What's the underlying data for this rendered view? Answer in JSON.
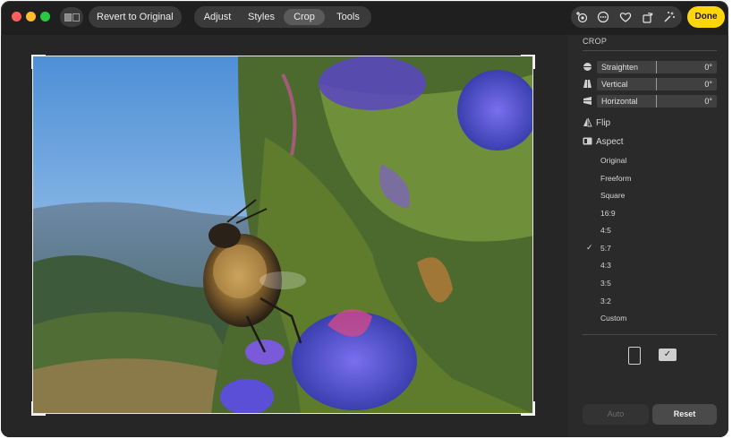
{
  "toolbar": {
    "revert_label": "Revert to Original",
    "tabs": [
      {
        "label": "Adjust"
      },
      {
        "label": "Styles"
      },
      {
        "label": "Crop",
        "active": true
      },
      {
        "label": "Tools"
      }
    ],
    "icons": [
      "add-enhance-icon",
      "more-icon",
      "favorite-heart-icon",
      "rotate-icon",
      "auto-enhance-wand-icon"
    ],
    "done_label": "Done",
    "done_color": "#ffd60a"
  },
  "crop_panel": {
    "title": "CROP",
    "sliders": [
      {
        "label": "Straighten",
        "value": "0°"
      },
      {
        "label": "Vertical",
        "value": "0°"
      },
      {
        "label": "Horizontal",
        "value": "0°"
      }
    ],
    "flip_label": "Flip",
    "aspect_label": "Aspect",
    "aspect_options": [
      "Original",
      "Freeform",
      "Square",
      "16:9",
      "4:5",
      "5:7",
      "4:3",
      "3:5",
      "3:2",
      "Custom"
    ],
    "aspect_selected": "5:7",
    "check_glyph": "✓",
    "orientation_selected": "landscape",
    "auto_label": "Auto",
    "reset_label": "Reset"
  }
}
